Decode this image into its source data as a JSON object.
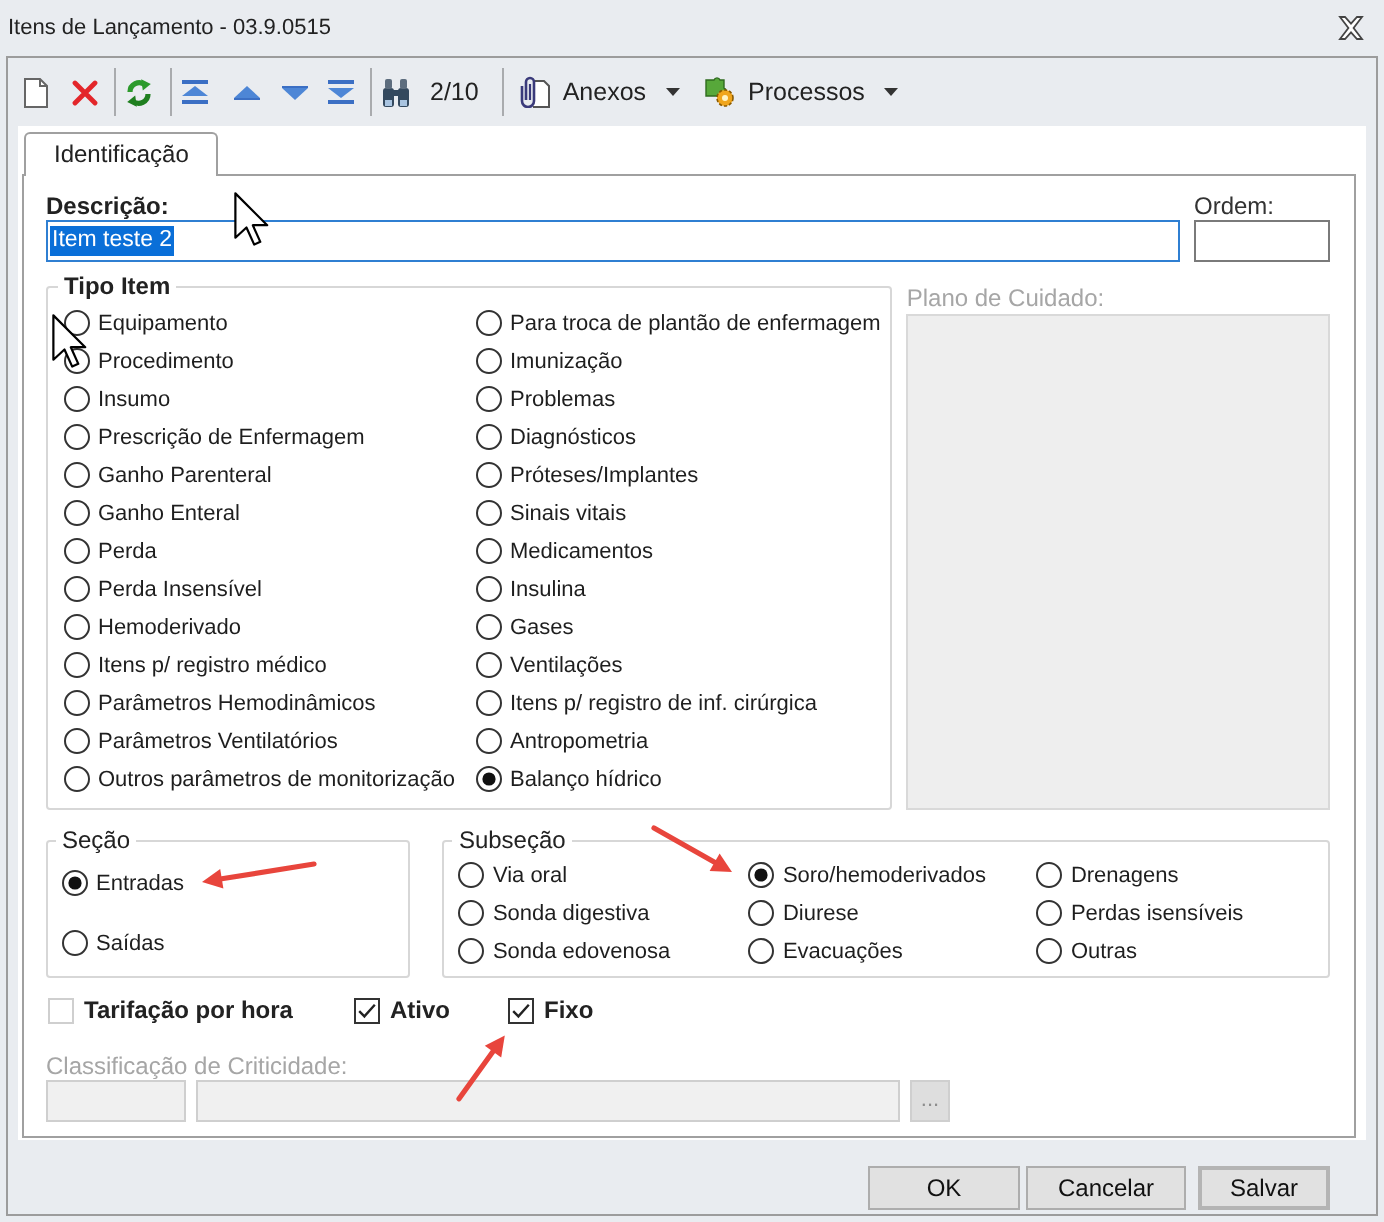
{
  "window": {
    "title": "Itens de Lançamento - 03.9.0515"
  },
  "toolbar": {
    "record_counter": "2/10",
    "attachments_menu": {
      "label": "Anexos"
    },
    "processes_menu": {
      "label": "Processos"
    }
  },
  "tabs": [
    {
      "label": "Identificação",
      "selected": true
    }
  ],
  "description": {
    "label": "Descrição:",
    "value": "Item teste 2",
    "value_selected": true
  },
  "order": {
    "label": "Ordem:"
  },
  "item_type": {
    "title": "Tipo Item",
    "options": [
      {
        "label": "Equipamento",
        "selected": false
      },
      {
        "label": "Procedimento",
        "selected": false
      },
      {
        "label": "Insumo",
        "selected": false
      },
      {
        "label": "Prescrição de Enfermagem",
        "selected": false
      },
      {
        "label": "Ganho Parenteral",
        "selected": false
      },
      {
        "label": "Ganho Enteral",
        "selected": false
      },
      {
        "label": "Perda",
        "selected": false
      },
      {
        "label": "Perda Insensível",
        "selected": false
      },
      {
        "label": "Hemoderivado",
        "selected": false
      },
      {
        "label": "Itens p/ registro médico",
        "selected": false
      },
      {
        "label": "Parâmetros Hemodinâmicos",
        "selected": false
      },
      {
        "label": "Parâmetros Ventilatórios",
        "selected": false
      },
      {
        "label": "Outros parâmetros de monitorização",
        "selected": false
      },
      {
        "label": "Para troca de plantão de enfermagem",
        "selected": false
      },
      {
        "label": "Imunização",
        "selected": false
      },
      {
        "label": "Problemas",
        "selected": false
      },
      {
        "label": "Diagnósticos",
        "selected": false
      },
      {
        "label": "Próteses/Implantes",
        "selected": false
      },
      {
        "label": "Sinais vitais",
        "selected": false
      },
      {
        "label": "Medicamentos",
        "selected": false
      },
      {
        "label": "Insulina",
        "selected": false
      },
      {
        "label": "Gases",
        "selected": false
      },
      {
        "label": "Ventilações",
        "selected": false
      },
      {
        "label": "Itens p/ registro de inf. cirúrgica",
        "selected": false
      },
      {
        "label": "Antropometria",
        "selected": false
      },
      {
        "label": "Balanço hídrico",
        "selected": true
      }
    ]
  },
  "care_plan": {
    "label": "Plano de Cuidado:",
    "disabled": true
  },
  "section": {
    "title": "Seção",
    "options": [
      {
        "label": "Entradas",
        "selected": true
      },
      {
        "label": "Saídas",
        "selected": false
      }
    ]
  },
  "subsection": {
    "title": "Subseção",
    "options": [
      {
        "label": "Via oral",
        "selected": false
      },
      {
        "label": "Sonda digestiva",
        "selected": false
      },
      {
        "label": "Sonda edovenosa",
        "selected": false
      },
      {
        "label": "Soro/hemoderivados",
        "selected": true
      },
      {
        "label": "Diurese",
        "selected": false
      },
      {
        "label": "Evacuações",
        "selected": false
      },
      {
        "label": "Drenagens",
        "selected": false
      },
      {
        "label": "Perdas isensíveis",
        "selected": false
      },
      {
        "label": "Outras",
        "selected": false
      }
    ]
  },
  "flags": [
    {
      "label": "Tarifação por hora",
      "checked": false,
      "disabled": true
    },
    {
      "label": "Ativo",
      "checked": true,
      "disabled": false
    },
    {
      "label": "Fixo",
      "checked": true,
      "disabled": false
    }
  ],
  "criticality": {
    "label": "Classificação de Criticidade:",
    "button": "...",
    "disabled": true
  },
  "buttons": [
    {
      "label": "OK",
      "default": false
    },
    {
      "label": "Cancelar",
      "default": false
    },
    {
      "label": "Salvar",
      "default": true
    }
  ]
}
